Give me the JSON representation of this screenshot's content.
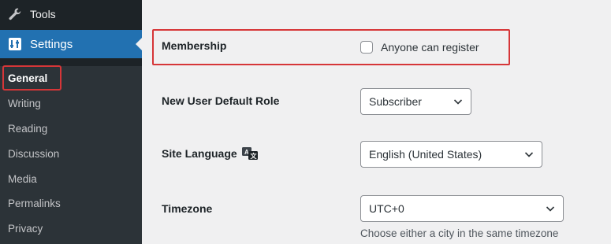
{
  "sidebar": {
    "tools": {
      "label": "Tools",
      "icon": "wrench-icon"
    },
    "settings": {
      "label": "Settings",
      "icon": "settings-sliders-icon"
    },
    "submenu": [
      {
        "label": "General",
        "current": true
      },
      {
        "label": "Writing"
      },
      {
        "label": "Reading"
      },
      {
        "label": "Discussion"
      },
      {
        "label": "Media"
      },
      {
        "label": "Permalinks"
      },
      {
        "label": "Privacy"
      }
    ]
  },
  "main": {
    "membership": {
      "label": "Membership",
      "checkbox_label": "Anyone can register",
      "checked": false
    },
    "default_role": {
      "label": "New User Default Role",
      "value": "Subscriber"
    },
    "site_language": {
      "label": "Site Language",
      "value": "English (United States)",
      "icon": "translation-icon"
    },
    "timezone": {
      "label": "Timezone",
      "value": "UTC+0",
      "description": "Choose either a city in the same timezone"
    }
  },
  "colors": {
    "sidebar_bg": "#1d2327",
    "submenu_bg": "#2c3338",
    "accent": "#2271b1",
    "highlight": "#d63638",
    "page_bg": "#f0f0f1"
  }
}
